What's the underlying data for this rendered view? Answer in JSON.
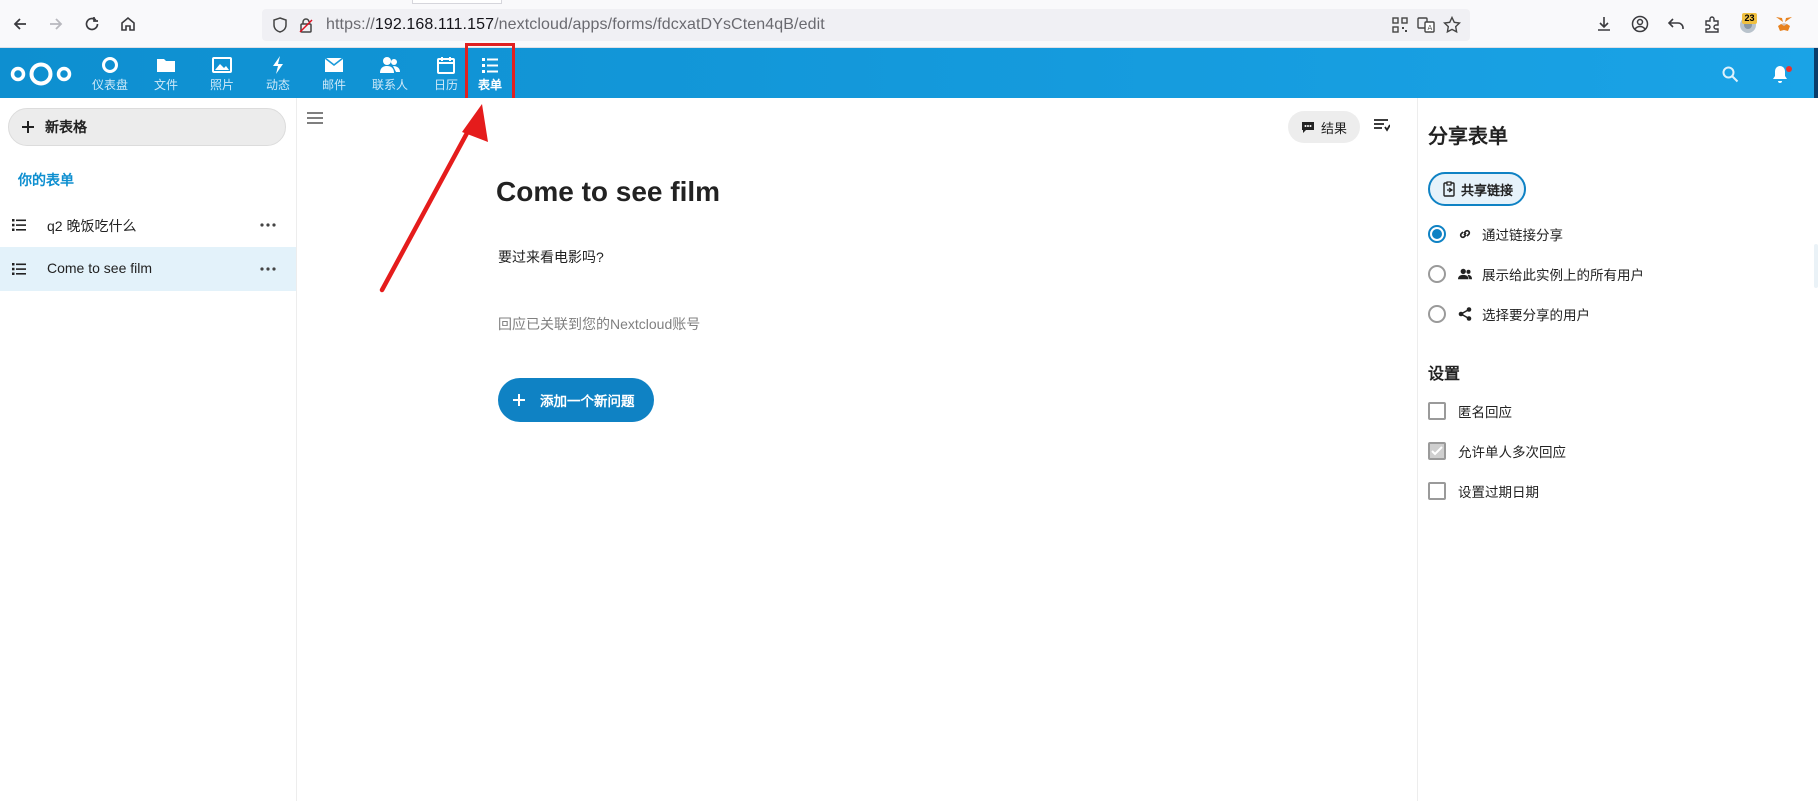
{
  "browser": {
    "url_prefix": "https://",
    "url_host": "192.168.111.157",
    "url_path": "/nextcloud/apps/forms/fdcxatDYsCten4qB/edit",
    "extension_badge": "23"
  },
  "header": {
    "apps": [
      {
        "label": "仪表盘",
        "icon": "dashboard-icon"
      },
      {
        "label": "文件",
        "icon": "folder-icon"
      },
      {
        "label": "照片",
        "icon": "image-icon"
      },
      {
        "label": "动态",
        "icon": "lightning-icon"
      },
      {
        "label": "邮件",
        "icon": "mail-icon"
      },
      {
        "label": "联系人",
        "icon": "contacts-icon"
      },
      {
        "label": "日历",
        "icon": "calendar-icon"
      },
      {
        "label": "表单",
        "icon": "list-icon"
      }
    ],
    "active_app": "表单",
    "brand_color": "#0f9bd9"
  },
  "sidebar": {
    "new_button_label": "新表格",
    "section_title": "你的表单",
    "forms": [
      {
        "title": "q2 晚饭吃什么",
        "active": false
      },
      {
        "title": "Come to see film",
        "active": true
      }
    ]
  },
  "main": {
    "results_label": "结果",
    "form_title": "Come to see film",
    "form_description": "要过来看电影吗?",
    "form_note": "回应已关联到您的Nextcloud账号",
    "add_question_label": "添加一个新问题"
  },
  "right_sidebar": {
    "title": "分享表单",
    "share_link_label": "共享链接",
    "share_options": [
      {
        "label": "通过链接分享",
        "icon": "link-icon",
        "selected": true
      },
      {
        "label": "展示给此实例上的所有用户",
        "icon": "users-icon",
        "selected": false
      },
      {
        "label": "选择要分享的用户",
        "icon": "share-icon",
        "selected": false
      }
    ],
    "settings_title": "设置",
    "settings": [
      {
        "label": "匿名回应",
        "checked": false
      },
      {
        "label": "允许单人多次回应",
        "checked": true
      },
      {
        "label": "设置过期日期",
        "checked": false
      }
    ]
  },
  "annotation_color": "#e02020"
}
